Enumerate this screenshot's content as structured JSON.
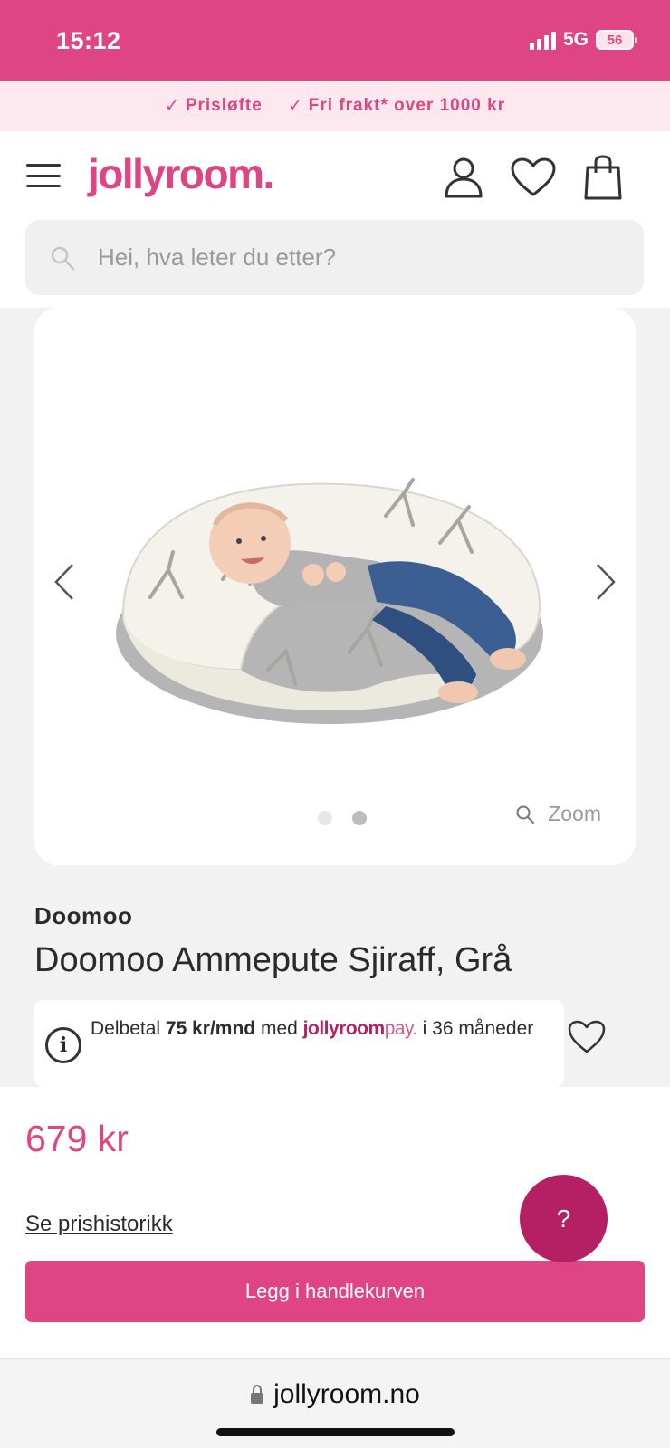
{
  "status_bar": {
    "time": "15:12",
    "network": "5G",
    "battery": "56"
  },
  "promo": {
    "items": [
      "Prisløfte",
      "Fri frakt* over 1000 kr"
    ],
    "icon": "check-icon"
  },
  "header": {
    "logo": "jollyroom.",
    "icons": [
      "menu-icon",
      "user-icon",
      "heart-icon",
      "bag-icon"
    ],
    "search_placeholder": "Hei, hva leter du etter?"
  },
  "gallery": {
    "image_alt": "baby-on-nursing-pillow",
    "dots": 2,
    "active_dot": 2,
    "zoom_label": "Zoom"
  },
  "product": {
    "brand": "Doomoo",
    "title": "Doomoo Ammepute Sjiraff, Grå",
    "installment": {
      "prefix": "Delbetal",
      "amount": "75 kr/mnd",
      "middle": "med",
      "pay_brand": "jollyroom",
      "pay_suffix": "pay.",
      "suffix": "i 36 måneder"
    },
    "price": "679 kr",
    "history_link": "Se prishistorikk",
    "cart_button": "Legg i handlekurven",
    "help_button": "?"
  },
  "browser": {
    "url": "jollyroom.no"
  },
  "colors": {
    "brand_pink": "#e04583",
    "dark_pink": "#b51f63",
    "promo_bg": "#fce8ee"
  }
}
